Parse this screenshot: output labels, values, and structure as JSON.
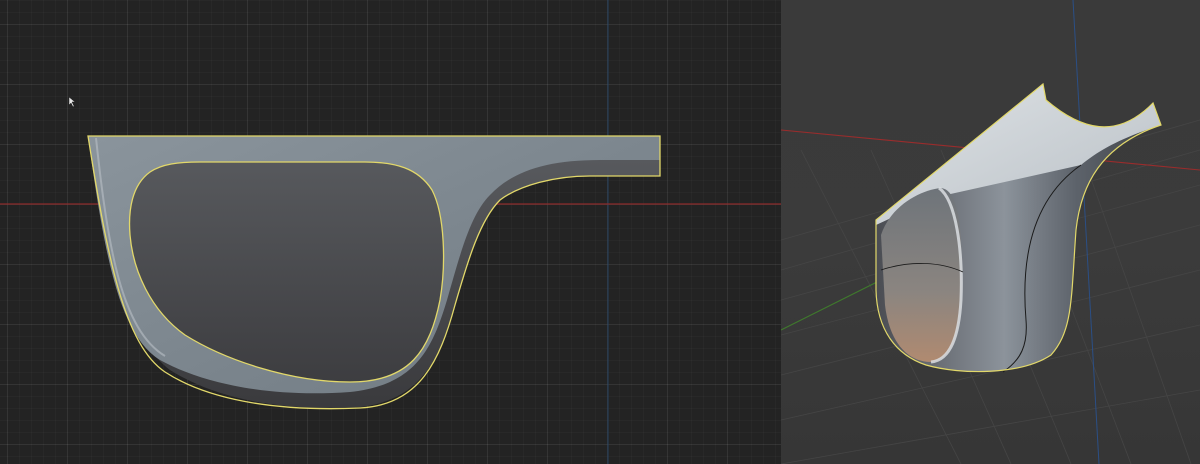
{
  "viewports": [
    {
      "name": "front-orthographic-viewport",
      "projection": "orthographic"
    },
    {
      "name": "user-perspective-viewport",
      "projection": "perspective"
    }
  ],
  "colors": {
    "background_ortho": "#232323",
    "background_perspective": "#3a3a3a",
    "x_axis": "#9a2c2c",
    "y_axis": "#3f7a2c",
    "z_axis": "#2b4f86",
    "selection_outline": "#e8e06a",
    "surface_light": "#7d8790",
    "surface_dark": "#3f3f43"
  },
  "object": {
    "icon": "glasses-frame-mesh",
    "state": "selected"
  },
  "cursor_icon": "arrow-pointer-icon"
}
